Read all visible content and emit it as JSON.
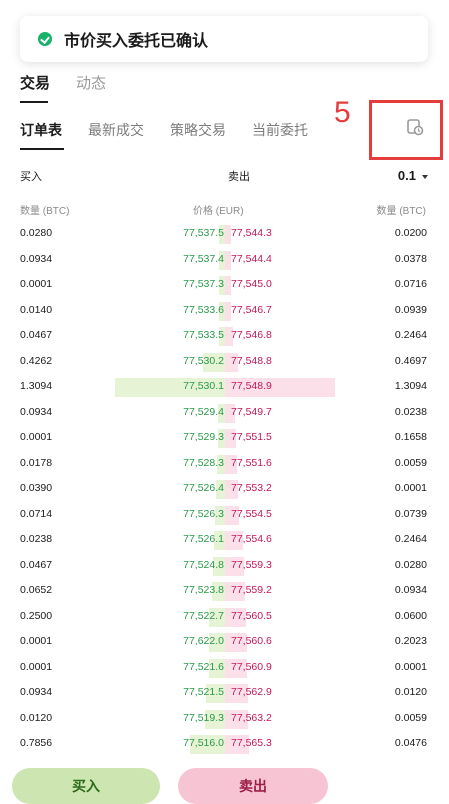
{
  "toast": {
    "text": "市价买入委托已确认"
  },
  "top_tabs": [
    {
      "label": "交易",
      "active": true
    },
    {
      "label": "动态",
      "active": false
    }
  ],
  "sub_tabs": [
    {
      "label": "订单表",
      "active": true
    },
    {
      "label": "最新成交",
      "active": false
    },
    {
      "label": "策略交易",
      "active": false
    },
    {
      "label": "当前委托",
      "active": false
    }
  ],
  "annotation": {
    "number": "5"
  },
  "order_book": {
    "buy_label": "买入",
    "sell_label": "卖出",
    "precision": "0.1",
    "headers": {
      "qty_left": "数量 (BTC)",
      "price": "价格 (EUR)",
      "qty_right": "数量 (BTC)"
    },
    "rows": [
      {
        "bid_qty": "0.0280",
        "bid_price": "77,537.5",
        "ask_price": "77,544.3",
        "ask_qty": "0.0200",
        "bid_depth": 0.01,
        "ask_depth": 0.02
      },
      {
        "bid_qty": "0.0934",
        "bid_price": "77,537.4",
        "ask_price": "77,544.4",
        "ask_qty": "0.0378",
        "bid_depth": 0.03,
        "ask_depth": 0.03
      },
      {
        "bid_qty": "0.0001",
        "bid_price": "77,537.3",
        "ask_price": "77,545.0",
        "ask_qty": "0.0716",
        "bid_depth": 0.03,
        "ask_depth": 0.04
      },
      {
        "bid_qty": "0.0140",
        "bid_price": "77,533.6",
        "ask_price": "77,546.7",
        "ask_qty": "0.0939",
        "bid_depth": 0.04,
        "ask_depth": 0.05
      },
      {
        "bid_qty": "0.0467",
        "bid_price": "77,533.5",
        "ask_price": "77,546.8",
        "ask_qty": "0.2464",
        "bid_depth": 0.05,
        "ask_depth": 0.07
      },
      {
        "bid_qty": "0.4262",
        "bid_price": "77,530.2",
        "ask_price": "77,548.8",
        "ask_qty": "0.4697",
        "bid_depth": 0.2,
        "ask_depth": 0.12
      },
      {
        "bid_qty": "1.3094",
        "bid_price": "77,530.1",
        "ask_price": "77,548.9",
        "ask_qty": "1.3094",
        "bid_depth": 1.0,
        "ask_depth": 1.0
      },
      {
        "bid_qty": "0.0934",
        "bid_price": "77,529.4",
        "ask_price": "77,549.7",
        "ask_qty": "0.0238",
        "bid_depth": 0.06,
        "ask_depth": 0.09
      },
      {
        "bid_qty": "0.0001",
        "bid_price": "77,529.3",
        "ask_price": "77,551.5",
        "ask_qty": "0.1658",
        "bid_depth": 0.06,
        "ask_depth": 0.1
      },
      {
        "bid_qty": "0.0178",
        "bid_price": "77,528.3",
        "ask_price": "77,551.6",
        "ask_qty": "0.0059",
        "bid_depth": 0.07,
        "ask_depth": 0.11
      },
      {
        "bid_qty": "0.0390",
        "bid_price": "77,526.4",
        "ask_price": "77,553.2",
        "ask_qty": "0.0001",
        "bid_depth": 0.08,
        "ask_depth": 0.12
      },
      {
        "bid_qty": "0.0714",
        "bid_price": "77,526.3",
        "ask_price": "77,554.5",
        "ask_qty": "0.0739",
        "bid_depth": 0.09,
        "ask_depth": 0.13
      },
      {
        "bid_qty": "0.0238",
        "bid_price": "77,526.1",
        "ask_price": "77,554.6",
        "ask_qty": "0.2464",
        "bid_depth": 0.1,
        "ask_depth": 0.16
      },
      {
        "bid_qty": "0.0467",
        "bid_price": "77,524.8",
        "ask_price": "77,559.3",
        "ask_qty": "0.0280",
        "bid_depth": 0.11,
        "ask_depth": 0.17
      },
      {
        "bid_qty": "0.0652",
        "bid_price": "77,523.8",
        "ask_price": "77,559.2",
        "ask_qty": "0.0934",
        "bid_depth": 0.12,
        "ask_depth": 0.18
      },
      {
        "bid_qty": "0.2500",
        "bid_price": "77,522.7",
        "ask_price": "77,560.5",
        "ask_qty": "0.0600",
        "bid_depth": 0.15,
        "ask_depth": 0.19
      },
      {
        "bid_qty": "0.0001",
        "bid_price": "77,622.0",
        "ask_price": "77,560.6",
        "ask_qty": "0.2023",
        "bid_depth": 0.15,
        "ask_depth": 0.2
      },
      {
        "bid_qty": "0.0001",
        "bid_price": "77,521.6",
        "ask_price": "77,560.9",
        "ask_qty": "0.0001",
        "bid_depth": 0.15,
        "ask_depth": 0.2
      },
      {
        "bid_qty": "0.0934",
        "bid_price": "77,521.5",
        "ask_price": "77,562.9",
        "ask_qty": "0.0120",
        "bid_depth": 0.17,
        "ask_depth": 0.21
      },
      {
        "bid_qty": "0.0120",
        "bid_price": "77,519.3",
        "ask_price": "77,563.2",
        "ask_qty": "0.0059",
        "bid_depth": 0.18,
        "ask_depth": 0.21
      },
      {
        "bid_qty": "0.7856",
        "bid_price": "77,516.0",
        "ask_price": "77,565.3",
        "ask_qty": "0.0476",
        "bid_depth": 0.32,
        "ask_depth": 0.22
      }
    ]
  },
  "actions": {
    "buy_button": "买入",
    "sell_button": "卖出"
  },
  "colors": {
    "bid": "#2a9a4a",
    "ask": "#c2185b",
    "annotation": "#e53c3c",
    "toast_check": "#18b26b"
  }
}
